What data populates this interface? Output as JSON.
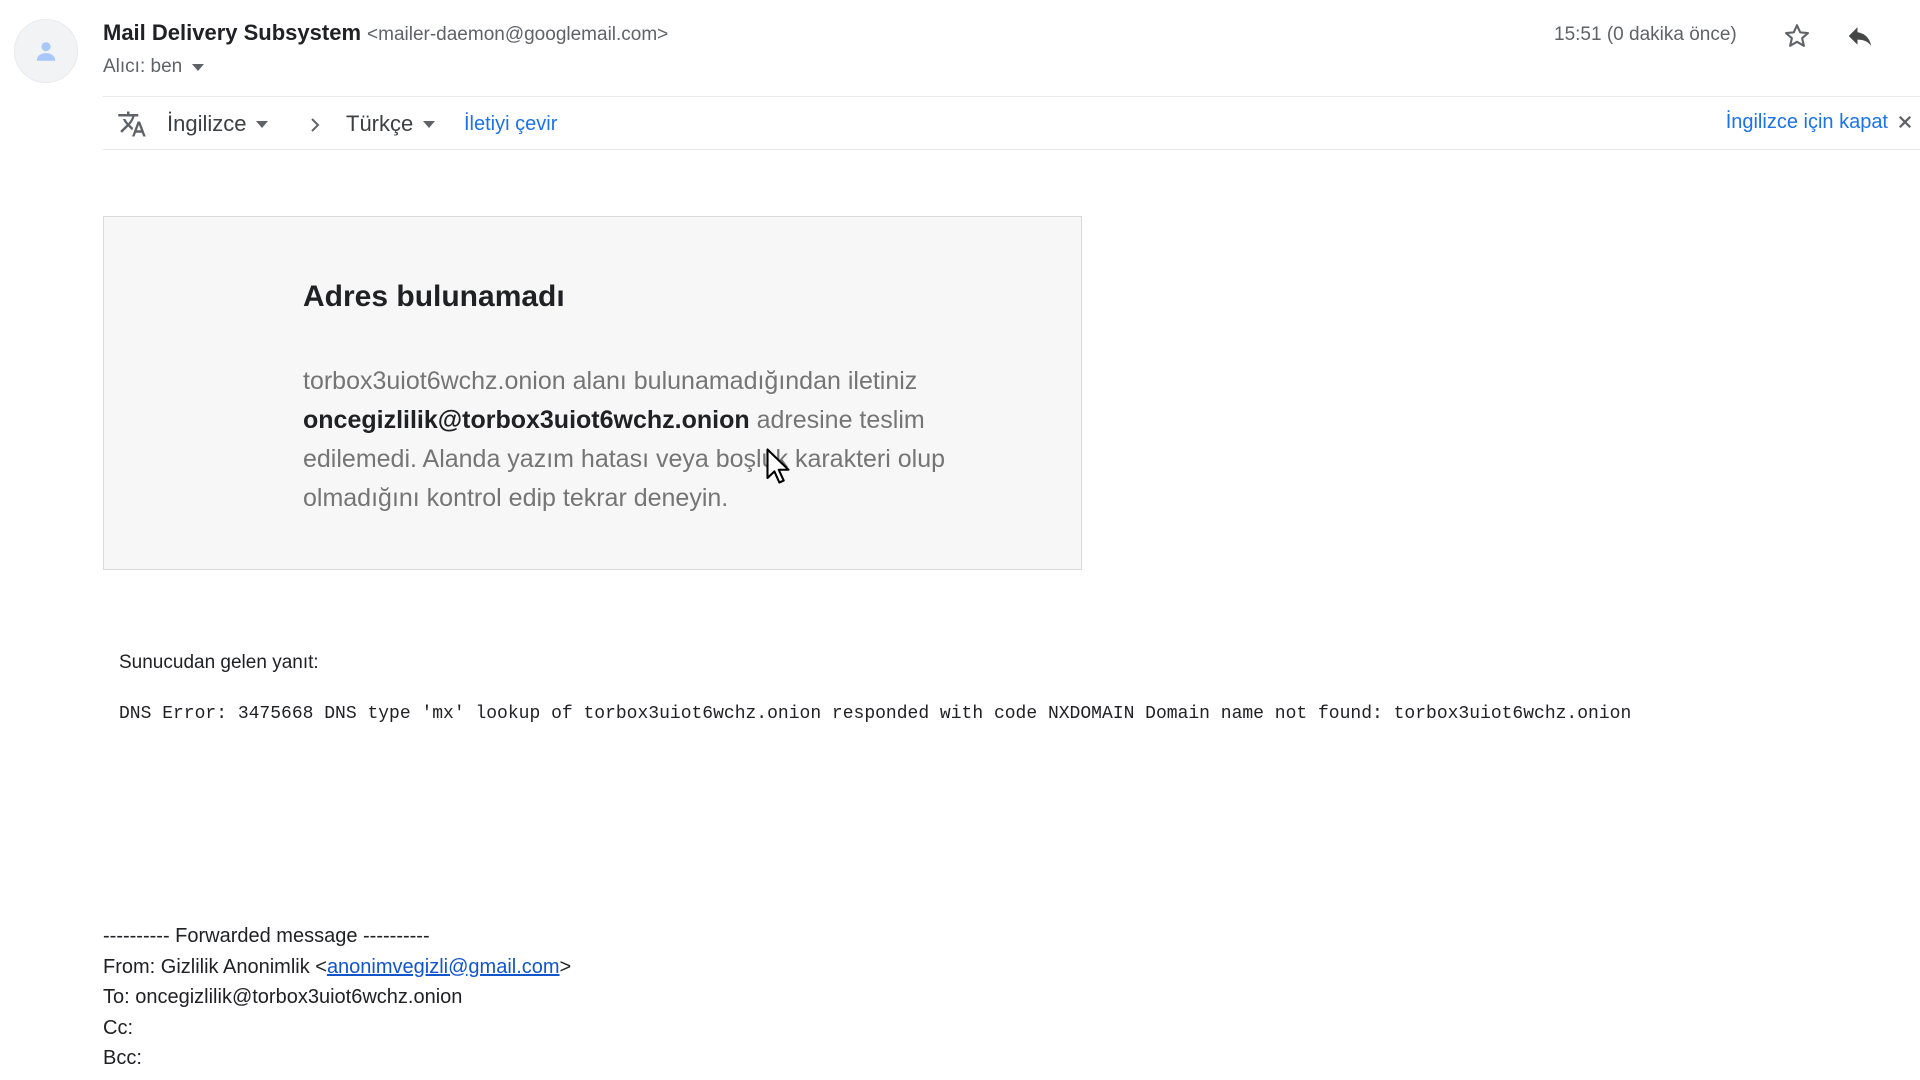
{
  "header": {
    "sender_name": "Mail Delivery Subsystem",
    "sender_email": "<mailer-daemon@googlemail.com>",
    "recipient_label": "Alıcı: ben",
    "timestamp": "15:51 (0 dakika önce)"
  },
  "icons": {
    "avatar": "person-avatar-icon",
    "star": "star-outline-icon",
    "reply": "reply-arrow-icon",
    "translate": "translate-icon",
    "close": "close-x-icon"
  },
  "translate_bar": {
    "source_language": "İngilizce",
    "target_language": "Türkçe",
    "translate_link": "İletiyi çevir",
    "turn_off_link": "İngilizce için kapat"
  },
  "bounce": {
    "title": "Adres bulunamadı",
    "message_part1": "torbox3uiot6wchz.onion alanı bulunamadığından iletiniz",
    "message_address": "oncegizlilik@torbox3uiot6wchz.onion",
    "message_part2": "adresine teslim edilemedi. Alanda yazım hatası veya boşluk karakteri olup olmadığını kontrol edip tekrar deneyin."
  },
  "server_response": {
    "label": "Sunucudan gelen yanıt:",
    "dns_error": "DNS Error: 3475668 DNS type 'mx' lookup of torbox3uiot6wchz.onion responded with code NXDOMAIN Domain name not found: torbox3uiot6wchz.onion"
  },
  "forwarded": {
    "header": "---------- Forwarded message ----------",
    "from_prefix": "From: Gizlilik Anonimlik <",
    "from_email": "anonimvegizli@gmail.com",
    "from_suffix": ">",
    "to": "To: oncegizlilik@torbox3uiot6wchz.onion",
    "cc": "Cc:",
    "bcc": "Bcc:"
  },
  "colors": {
    "link_blue": "#1a73e8",
    "box_background": "#f7f7f7",
    "muted_text": "#5f6368"
  }
}
